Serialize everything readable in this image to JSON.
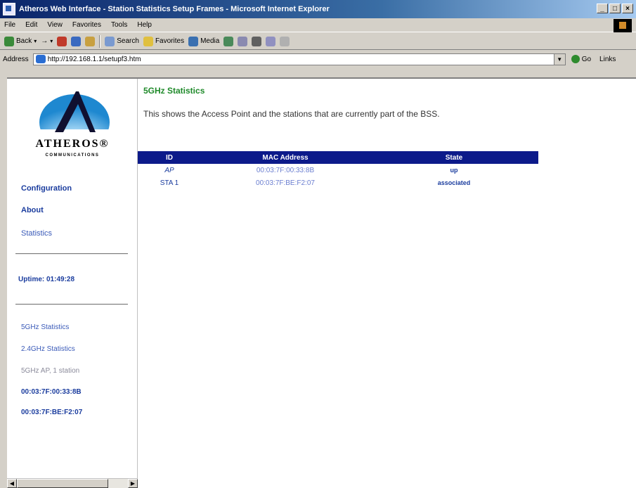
{
  "window": {
    "title": "Atheros Web Interface - Station Statistics Setup Frames - Microsoft Internet Explorer",
    "controls": [
      "_",
      "□",
      "×"
    ]
  },
  "menu": [
    "File",
    "Edit",
    "View",
    "Favorites",
    "Tools",
    "Help"
  ],
  "toolbar": {
    "back": "Back",
    "search": "Search",
    "favorites": "Favorites",
    "media": "Media"
  },
  "address": {
    "label": "Address",
    "url": "http://192.168.1.1/setupf3.htm",
    "go": "Go",
    "links": "Links"
  },
  "sidebar": {
    "logo_text": "ATHEROS®",
    "logo_sub": "COMMUNICATIONS",
    "nav": [
      {
        "label": "Configuration"
      },
      {
        "label": "About"
      },
      {
        "label": "Statistics"
      }
    ],
    "uptime": "Uptime: 01:49:28",
    "stats_links": [
      {
        "label": "5GHz Statistics"
      },
      {
        "label": "2.4GHz Statistics"
      }
    ],
    "ap_info": "5GHz AP, 1 station",
    "macs": [
      "00:03:7F:00:33:8B",
      "00:03:7F:BE:F2:07"
    ]
  },
  "main": {
    "title": "5GHz Statistics",
    "description": "This shows the Access Point and the stations that are currently part of the BSS.",
    "columns": [
      "ID",
      "MAC Address",
      "State"
    ],
    "rows": [
      {
        "id": "AP",
        "mac": "00:03:7F:00:33:8B",
        "state": "up"
      },
      {
        "id": "STA 1",
        "mac": "00:03:7F:BE:F2:07",
        "state": "associated"
      }
    ]
  }
}
